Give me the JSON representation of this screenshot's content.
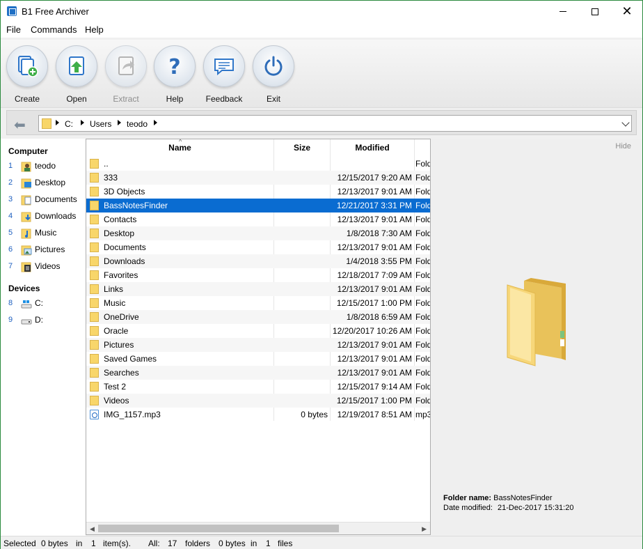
{
  "window": {
    "title": "B1 Free Archiver"
  },
  "menu": [
    "File",
    "Commands",
    "Help"
  ],
  "toolbar": {
    "create": "Create",
    "open": "Open",
    "extract": "Extract",
    "help": "Help",
    "feedback": "Feedback",
    "exit": "Exit"
  },
  "address": {
    "crumbs": [
      "C:",
      "Users",
      "teodo"
    ]
  },
  "nav": {
    "computer_heading": "Computer",
    "computer_items": [
      {
        "num": "1",
        "label": "teodo",
        "icon": "user-icon"
      },
      {
        "num": "2",
        "label": "Desktop",
        "icon": "desktop-icon"
      },
      {
        "num": "3",
        "label": "Documents",
        "icon": "documents-icon"
      },
      {
        "num": "4",
        "label": "Downloads",
        "icon": "downloads-icon"
      },
      {
        "num": "5",
        "label": "Music",
        "icon": "music-icon"
      },
      {
        "num": "6",
        "label": "Pictures",
        "icon": "pictures-icon"
      },
      {
        "num": "7",
        "label": "Videos",
        "icon": "videos-icon"
      }
    ],
    "devices_heading": "Devices",
    "device_items": [
      {
        "num": "8",
        "label": "C:",
        "icon": "drive-icon"
      },
      {
        "num": "9",
        "label": "D:",
        "icon": "drive-icon"
      }
    ]
  },
  "filelist": {
    "columns": {
      "name": "Name",
      "size": "Size",
      "modified": "Modified"
    },
    "rows": [
      {
        "name": "..",
        "size": "",
        "modified": "",
        "type": "Fold"
      },
      {
        "name": "333",
        "size": "",
        "modified": "12/15/2017 9:20 AM",
        "type": "Fold"
      },
      {
        "name": "3D Objects",
        "size": "",
        "modified": "12/13/2017 9:01 AM",
        "type": "Fold"
      },
      {
        "name": "BassNotesFinder",
        "size": "",
        "modified": "12/21/2017 3:31 PM",
        "type": "Fold"
      },
      {
        "name": "Contacts",
        "size": "",
        "modified": "12/13/2017 9:01 AM",
        "type": "Fold"
      },
      {
        "name": "Desktop",
        "size": "",
        "modified": "1/8/2018 7:30 AM",
        "type": "Fold"
      },
      {
        "name": "Documents",
        "size": "",
        "modified": "12/13/2017 9:01 AM",
        "type": "Fold"
      },
      {
        "name": "Downloads",
        "size": "",
        "modified": "1/4/2018 3:55 PM",
        "type": "Fold"
      },
      {
        "name": "Favorites",
        "size": "",
        "modified": "12/18/2017 7:09 AM",
        "type": "Fold"
      },
      {
        "name": "Links",
        "size": "",
        "modified": "12/13/2017 9:01 AM",
        "type": "Fold"
      },
      {
        "name": "Music",
        "size": "",
        "modified": "12/15/2017 1:00 PM",
        "type": "Fold"
      },
      {
        "name": "OneDrive",
        "size": "",
        "modified": "1/8/2018 6:59 AM",
        "type": "Fold"
      },
      {
        "name": "Oracle",
        "size": "",
        "modified": "12/20/2017 10:26 AM",
        "type": "Fold"
      },
      {
        "name": "Pictures",
        "size": "",
        "modified": "12/13/2017 9:01 AM",
        "type": "Fold"
      },
      {
        "name": "Saved Games",
        "size": "",
        "modified": "12/13/2017 9:01 AM",
        "type": "Fold"
      },
      {
        "name": "Searches",
        "size": "",
        "modified": "12/13/2017 9:01 AM",
        "type": "Fold"
      },
      {
        "name": "Test 2",
        "size": "",
        "modified": "12/15/2017 9:14 AM",
        "type": "Fold"
      },
      {
        "name": "Videos",
        "size": "",
        "modified": "12/15/2017 1:00 PM",
        "type": "Fold"
      },
      {
        "name": "IMG_1157.mp3",
        "size": "0 bytes",
        "modified": "12/19/2017 8:51 AM",
        "type": "mp3"
      }
    ],
    "selected_name": "BassNotesFinder"
  },
  "preview": {
    "hide": "Hide",
    "folder_name_label": "Folder name:",
    "folder_name": "BassNotesFinder",
    "date_label": "Date modified:",
    "date_value": "21-Dec-2017 15:31:20"
  },
  "status": {
    "selected": "Selected",
    "sel_bytes": "0 bytes",
    "in1": "in",
    "sel_count": "1",
    "items": "item(s).",
    "all": "All:",
    "all_count": "17",
    "folders": "folders",
    "all_bytes": "0 bytes",
    "in2": "in",
    "file_count": "1",
    "files": "files"
  },
  "colors": {
    "selection": "#0a6cd1",
    "folder": "#f8d66a",
    "link_number": "#1d5fbf"
  }
}
